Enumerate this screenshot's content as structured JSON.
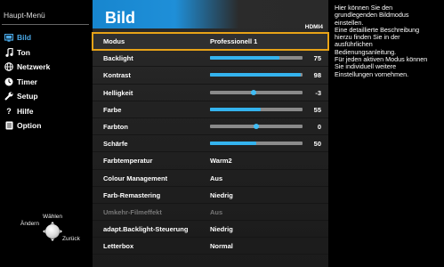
{
  "menu": {
    "title": "Haupt-Menü",
    "items": [
      {
        "label": "Bild",
        "icon": "picture-icon",
        "active": true
      },
      {
        "label": "Ton",
        "icon": "music-note-icon",
        "active": false
      },
      {
        "label": "Netzwerk",
        "icon": "globe-icon",
        "active": false
      },
      {
        "label": "Timer",
        "icon": "clock-icon",
        "active": false
      },
      {
        "label": "Setup",
        "icon": "wrench-icon",
        "active": false
      },
      {
        "label": "Hilfe",
        "icon": "question-icon",
        "active": false
      },
      {
        "label": "Option",
        "icon": "option-icon",
        "active": false
      }
    ]
  },
  "nav": {
    "select": "Wählen",
    "change": "Ändern",
    "back": "Zurück"
  },
  "panel": {
    "title": "Bild",
    "source": "HDMI4",
    "rows": [
      {
        "label": "Modus",
        "value": "Professionell 1",
        "selected": true
      },
      {
        "label": "Backlight",
        "slider": 0.75,
        "num": "75"
      },
      {
        "label": "Kontrast",
        "slider": 0.98,
        "num": "98"
      },
      {
        "label": "Helligkeit",
        "knob": 0.47,
        "num": "-3"
      },
      {
        "label": "Farbe",
        "slider": 0.55,
        "num": "55"
      },
      {
        "label": "Farbton",
        "knob": 0.5,
        "num": "0"
      },
      {
        "label": "Schärfe",
        "slider": 0.5,
        "num": "50"
      },
      {
        "label": "Farbtemperatur",
        "value": "Warm2"
      },
      {
        "label": "Colour Management",
        "value": "Aus"
      },
      {
        "label": "Farb-Remastering",
        "value": "Niedrig"
      },
      {
        "label": "Umkehr-Filmeffekt",
        "value": "Aus",
        "disabled": true
      },
      {
        "label": "adapt.Backlight-Steuerung",
        "value": "Niedrig"
      },
      {
        "label": "Letterbox",
        "value": "Normal"
      }
    ]
  },
  "help": {
    "lines": [
      "Hier können Sie den",
      "grundlegenden Bildmodus",
      "einstellen.",
      "Eine detaillierte Beschreibung",
      "hierzu finden Sie in der",
      "ausführlichen",
      "Bedienungsanleitung.",
      "Für jeden aktiven Modus können",
      "Sie individuell weitere",
      "Einstellungen vornehmen."
    ]
  },
  "colors": {
    "accent": "#1a8ad4",
    "highlight": "#e8a317",
    "slider_fill": "#34b3ee"
  }
}
